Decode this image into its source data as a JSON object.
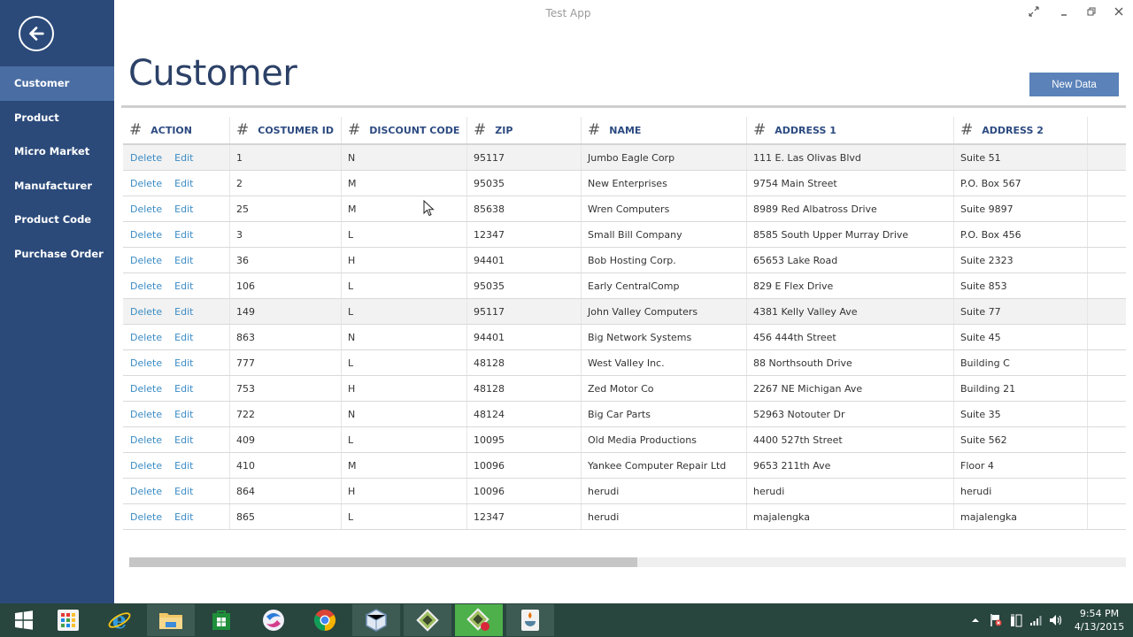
{
  "window": {
    "title": "Test App",
    "controls": [
      "fullscreen-icon",
      "minimize-icon",
      "restore-icon",
      "close-icon"
    ]
  },
  "sidebar": {
    "back_icon": "arrow-left-icon",
    "items": [
      {
        "label": "Customer",
        "active": true
      },
      {
        "label": "Product",
        "active": false
      },
      {
        "label": "Micro Market",
        "active": false
      },
      {
        "label": "Manufacturer",
        "active": false
      },
      {
        "label": "Product Code",
        "active": false
      },
      {
        "label": "Purchase Order",
        "active": false
      }
    ]
  },
  "main": {
    "page_title": "Customer",
    "new_data_label": "New Data",
    "grid": {
      "header_icon": "#",
      "columns": [
        "ACTION",
        "COSTUMER ID",
        "DISCOUNT CODE",
        "ZIP",
        "NAME",
        "ADDRESS 1",
        "ADDRESS 2"
      ],
      "action_labels": {
        "delete": "Delete",
        "edit": "Edit"
      },
      "rows": [
        {
          "id": "1",
          "discount": "N",
          "zip": "95117",
          "name": "Jumbo Eagle Corp",
          "address1": "111 E. Las Olivas Blvd",
          "address2": "Suite 51"
        },
        {
          "id": "2",
          "discount": "M",
          "zip": "95035",
          "name": "New Enterprises",
          "address1": "9754 Main Street",
          "address2": "P.O. Box 567"
        },
        {
          "id": "25",
          "discount": "M",
          "zip": "85638",
          "name": "Wren Computers",
          "address1": "8989 Red Albatross Drive",
          "address2": "Suite 9897"
        },
        {
          "id": "3",
          "discount": "L",
          "zip": "12347",
          "name": "Small Bill Company",
          "address1": "8585 South Upper Murray Drive",
          "address2": "P.O. Box 456"
        },
        {
          "id": "36",
          "discount": "H",
          "zip": "94401",
          "name": "Bob Hosting Corp.",
          "address1": "65653 Lake Road",
          "address2": "Suite 2323"
        },
        {
          "id": "106",
          "discount": "L",
          "zip": "95035",
          "name": "Early CentralComp",
          "address1": "829 E Flex Drive",
          "address2": "Suite 853"
        },
        {
          "id": "149",
          "discount": "L",
          "zip": "95117",
          "name": "John Valley Computers",
          "address1": "4381 Kelly Valley Ave",
          "address2": "Suite 77"
        },
        {
          "id": "863",
          "discount": "N",
          "zip": "94401",
          "name": "Big Network Systems",
          "address1": "456 444th Street",
          "address2": "Suite 45"
        },
        {
          "id": "777",
          "discount": "L",
          "zip": "48128",
          "name": "West Valley Inc.",
          "address1": "88 Northsouth Drive",
          "address2": "Building C"
        },
        {
          "id": "753",
          "discount": "H",
          "zip": "48128",
          "name": "Zed Motor Co",
          "address1": "2267 NE Michigan Ave",
          "address2": "Building 21"
        },
        {
          "id": "722",
          "discount": "N",
          "zip": "48124",
          "name": "Big Car Parts",
          "address1": "52963 Notouter Dr",
          "address2": "Suite 35"
        },
        {
          "id": "409",
          "discount": "L",
          "zip": "10095",
          "name": "Old Media Productions",
          "address1": "4400 527th Street",
          "address2": "Suite 562"
        },
        {
          "id": "410",
          "discount": "M",
          "zip": "10096",
          "name": "Yankee Computer Repair Ltd",
          "address1": "9653 211th Ave",
          "address2": "Floor 4"
        },
        {
          "id": "864",
          "discount": "H",
          "zip": "10096",
          "name": "herudi",
          "address1": "herudi",
          "address2": "herudi"
        },
        {
          "id": "865",
          "discount": "L",
          "zip": "12347",
          "name": "herudi",
          "address1": "majalengka",
          "address2": "majalengka"
        }
      ],
      "shaded_rows": [
        0,
        6
      ]
    },
    "horizontal_scroll_thumb_fraction": 0.51
  },
  "taskbar": {
    "items": [
      {
        "name": "start-icon",
        "state": "none"
      },
      {
        "name": "apps-grid-icon",
        "state": "none"
      },
      {
        "name": "internet-explorer-icon",
        "state": "none"
      },
      {
        "name": "file-explorer-icon",
        "state": "open"
      },
      {
        "name": "store-icon",
        "state": "none"
      },
      {
        "name": "browser-swirl-icon",
        "state": "none"
      },
      {
        "name": "chrome-icon",
        "state": "none"
      },
      {
        "name": "virtualbox-cube-icon",
        "state": "open"
      },
      {
        "name": "netbeans-icon",
        "state": "open"
      },
      {
        "name": "netbeans-running-icon",
        "state": "active"
      },
      {
        "name": "java-icon",
        "state": "open"
      }
    ],
    "tray_icons": [
      "show-hidden-icons-chevron-icon",
      "action-center-flag-icon",
      "power-icon",
      "network-signal-icon",
      "volume-icon"
    ],
    "clock": {
      "time": "9:54 PM",
      "date": "4/13/2015"
    }
  }
}
